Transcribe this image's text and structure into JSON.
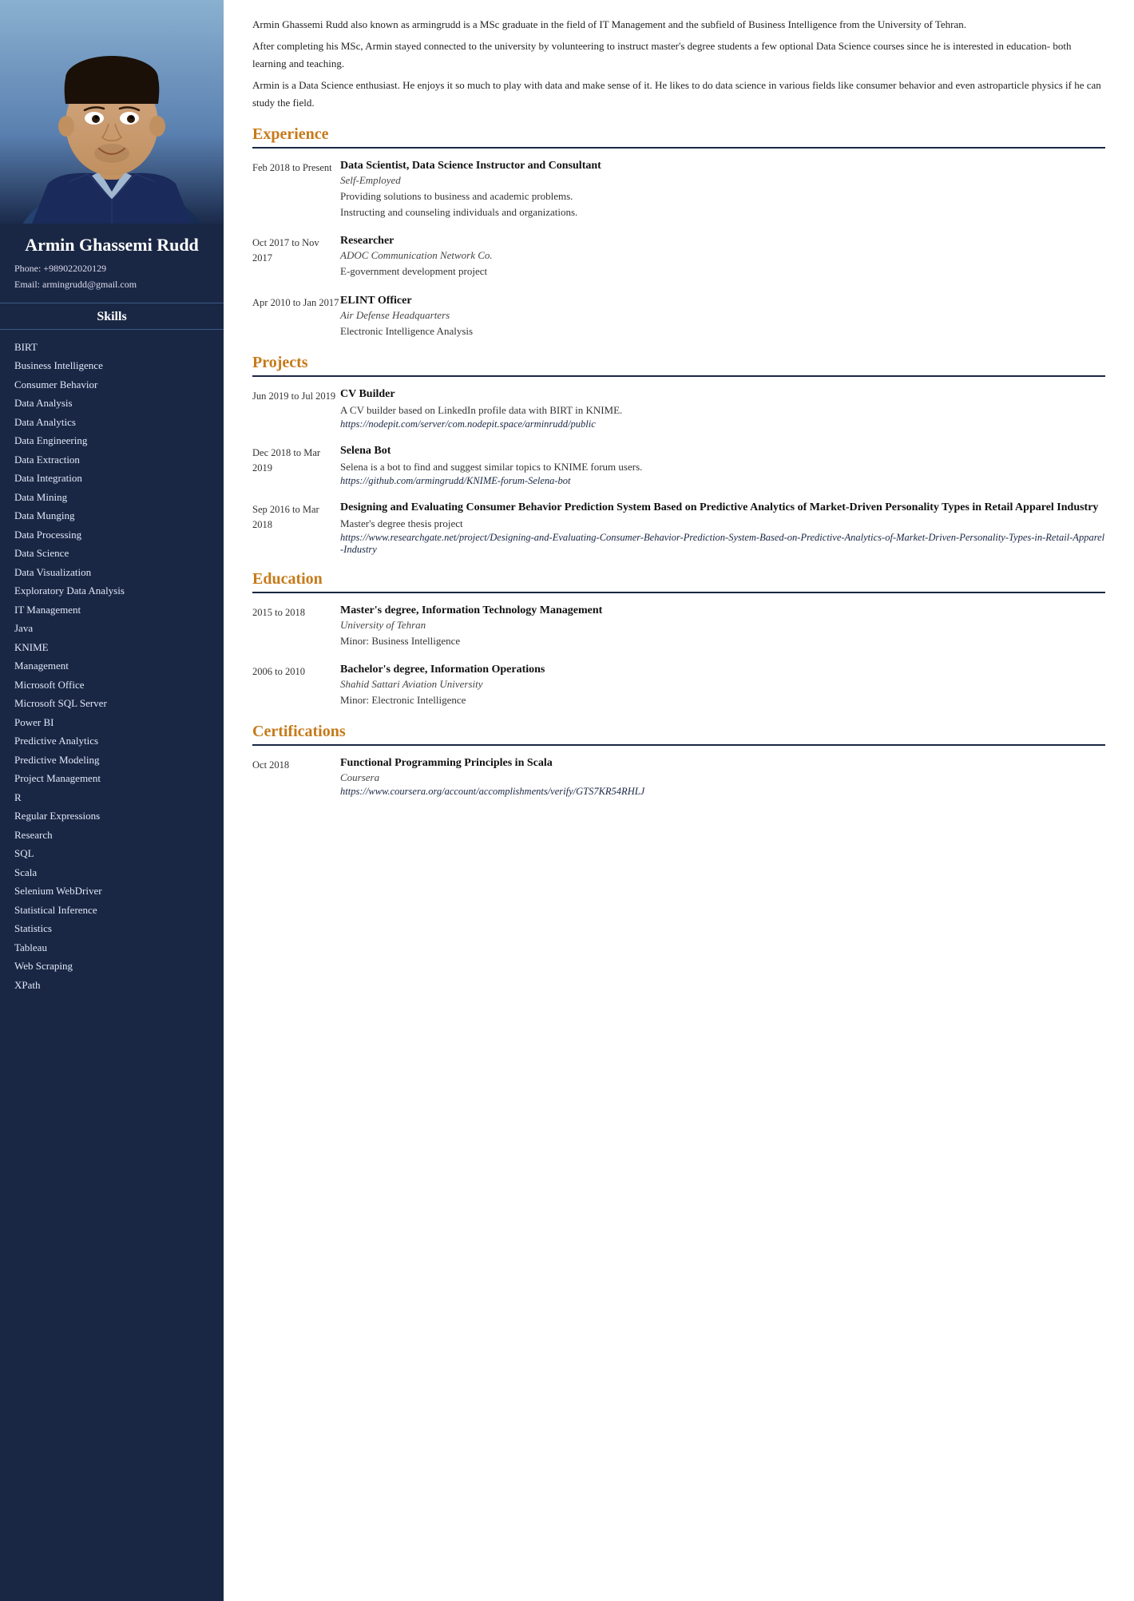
{
  "sidebar": {
    "name": "Armin Ghassemi Rudd",
    "phone_label": "Phone:",
    "phone_value": "+989022020129",
    "email_label": "Email:",
    "email_value": "armingrudd@gmail.com",
    "skills_title": "Skills",
    "skills": [
      "BIRT",
      "Business Intelligence",
      "Consumer Behavior",
      "Data Analysis",
      "Data Analytics",
      "Data Engineering",
      "Data Extraction",
      "Data Integration",
      "Data Mining",
      "Data Munging",
      "Data Processing",
      "Data Science",
      "Data Visualization",
      "Exploratory Data Analysis",
      "IT Management",
      "Java",
      "KNIME",
      "Management",
      "Microsoft Office",
      "Microsoft SQL Server",
      "Power BI",
      "Predictive Analytics",
      "Predictive Modeling",
      "Project Management",
      "R",
      "Regular Expressions",
      "Research",
      "SQL",
      "Scala",
      "Selenium WebDriver",
      "Statistical Inference",
      "Statistics",
      "Tableau",
      "Web Scraping",
      "XPath"
    ]
  },
  "bio": {
    "paragraph1": "Armin Ghassemi Rudd also known as armingrudd is a MSc graduate in the field of IT Management and the subfield of Business Intelligence from the University of Tehran.",
    "paragraph2": "After completing his MSc, Armin stayed connected to the university by volunteering to instruct master's degree students a few optional Data Science courses since he is interested in education- both learning and teaching.",
    "paragraph3": "Armin is a Data Science enthusiast. He enjoys it so much to play with data and make sense of it. He likes to do data science in various fields like consumer behavior and even astroparticle physics if he can study the field."
  },
  "sections": {
    "experience": {
      "title": "Experience",
      "entries": [
        {
          "date": "Feb 2018 to Present",
          "title": "Data Scientist, Data Science Instructor and Consultant",
          "subtitle": "Self-Employed",
          "desc": "Providing solutions to business and academic problems.\nInstructing and counseling individuals and organizations.",
          "link": ""
        },
        {
          "date": "Oct 2017 to Nov 2017",
          "title": "Researcher",
          "subtitle": "ADOC Communication Network Co.",
          "desc": "E-government development project",
          "link": ""
        },
        {
          "date": "Apr 2010 to Jan 2017",
          "title": "ELINT Officer",
          "subtitle": "Air Defense Headquarters",
          "desc": "Electronic Intelligence Analysis",
          "link": ""
        }
      ]
    },
    "projects": {
      "title": "Projects",
      "entries": [
        {
          "date": "Jun 2019 to Jul 2019",
          "title": "CV Builder",
          "subtitle": "",
          "desc": "A CV builder based on LinkedIn profile data with BIRT in KNIME.",
          "link": "https://nodepit.com/server/com.nodepit.space/arminrudd/public"
        },
        {
          "date": "Dec 2018 to Mar 2019",
          "title": "Selena Bot",
          "subtitle": "",
          "desc": "Selena is a bot to find and suggest similar topics to KNIME forum users.",
          "link": "https://github.com/armingrudd/KNIME-forum-Selena-bot"
        },
        {
          "date": "Sep 2016 to Mar 2018",
          "title": "Designing and Evaluating Consumer Behavior Prediction System Based on Predictive Analytics of Market-Driven Personality Types in Retail Apparel Industry",
          "subtitle": "",
          "desc": "Master's degree thesis project",
          "link": "https://www.researchgate.net/project/Designing-and-Evaluating-Consumer-Behavior-Prediction-System-Based-on-Predictive-Analytics-of-Market-Driven-Personality-Types-in-Retail-Apparel-Industry"
        }
      ]
    },
    "education": {
      "title": "Education",
      "entries": [
        {
          "date": "2015 to 2018",
          "title": "Master's degree, Information Technology Management",
          "subtitle": "University of Tehran",
          "desc": "Minor: Business Intelligence",
          "link": ""
        },
        {
          "date": "2006 to 2010",
          "title": "Bachelor's degree, Information Operations",
          "subtitle": "Shahid Sattari Aviation University",
          "desc": "Minor: Electronic Intelligence",
          "link": ""
        }
      ]
    },
    "certifications": {
      "title": "Certifications",
      "entries": [
        {
          "date": "Oct 2018",
          "title": "Functional Programming Principles in Scala",
          "subtitle": "Coursera",
          "desc": "",
          "link": "https://www.coursera.org/account/accomplishments/verify/GTS7KR54RHLJ"
        }
      ]
    }
  }
}
